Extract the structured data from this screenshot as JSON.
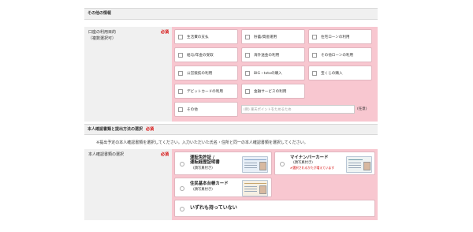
{
  "section_other": {
    "title": "その他の情報"
  },
  "purpose": {
    "label": "口座の利用目的",
    "label_sub": "（複数選択可）",
    "required": "必須",
    "options": [
      "生活費の支払",
      "貯蓄/資産運用",
      "住宅ローンの利用",
      "給与/年金の受取",
      "海外送金の利用",
      "その他ローンの利用",
      "公営競技の利用",
      "BIG・totoの購入",
      "宝くじの購入",
      "デビットカードの利用",
      "金融サービスの利用",
      "その他"
    ],
    "other_placeholder": "(例) 楽天ポイントをためるため",
    "other_suffix": "(任意)"
  },
  "section_id": {
    "title": "本人確認書類と提出方法の選択",
    "required": "必須",
    "notice": "※提出予定の本人確認書類を選択してください。入力いただいた氏名・住所と同一の本人確認書類を選択してください。"
  },
  "id_select": {
    "label": "本人確認書類の選択",
    "required": "必須",
    "options": [
      {
        "title": "運転免許証 /\n運転経歴証明書",
        "sub": "(顔写真付き)"
      },
      {
        "title": "マイナンバーカード",
        "sub": "(顔写真付き)",
        "warn": "✔選択されるかたが増えています"
      },
      {
        "title": "住民基本台帳カード",
        "sub": "(顔写真付き)"
      },
      {
        "title": "いずれも持っていない"
      }
    ]
  },
  "colors": {
    "accent_pink": "#f8c7d0",
    "required_red": "#d40000",
    "label_gray": "#f0f0f0"
  }
}
